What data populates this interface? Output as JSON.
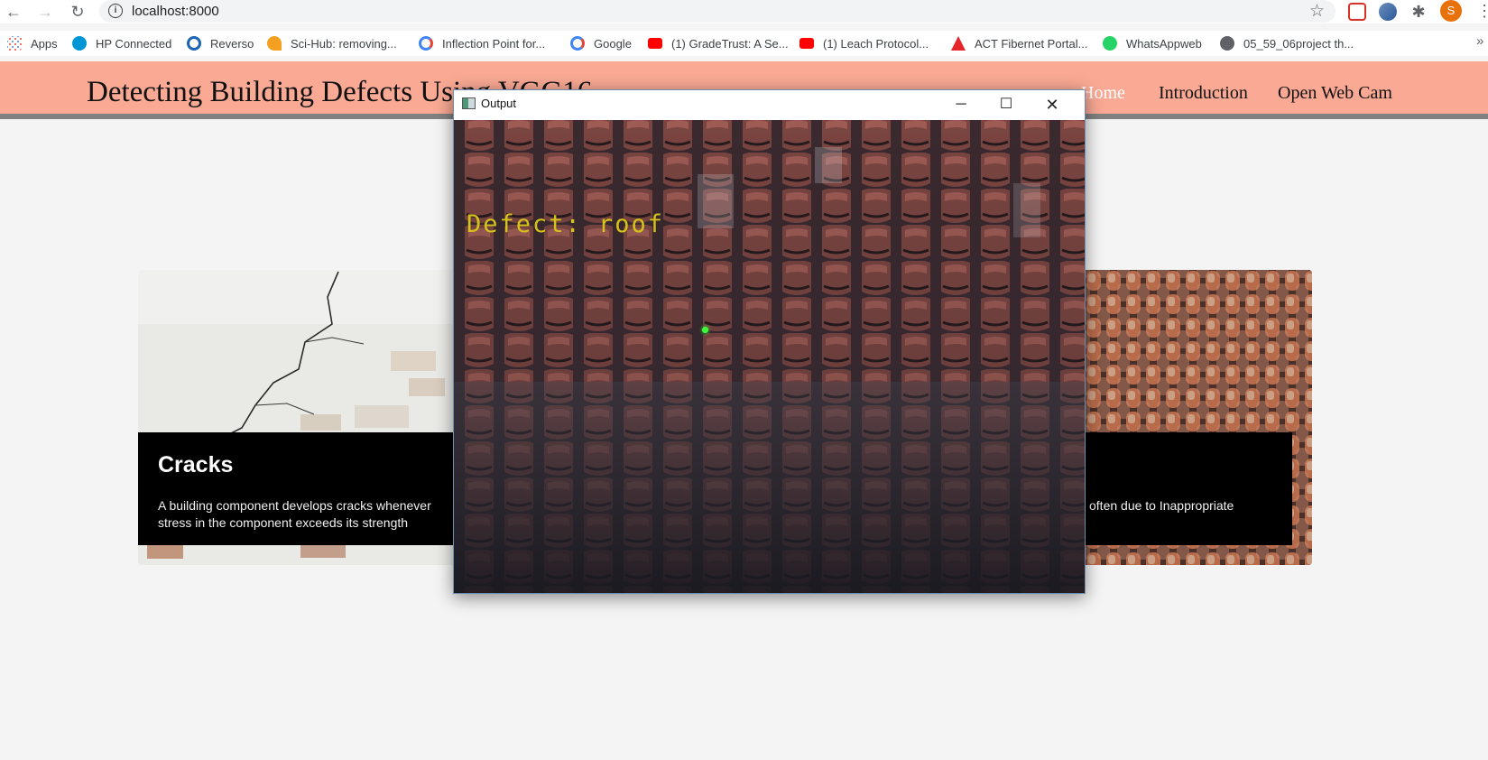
{
  "browser": {
    "url": "localhost:8000",
    "profile_initial": "S",
    "bookmarks": [
      {
        "label": "Apps",
        "icon": "apps-grid-icon"
      },
      {
        "label": "HP Connected",
        "icon": "hp-icon"
      },
      {
        "label": "Reverso",
        "icon": "reverso-icon"
      },
      {
        "label": "Sci-Hub: removing...",
        "icon": "scihub-icon"
      },
      {
        "label": "Inflection Point for...",
        "icon": "google-icon"
      },
      {
        "label": "Google",
        "icon": "google-icon"
      },
      {
        "label": "(1) GradeTrust: A Se...",
        "icon": "youtube-icon"
      },
      {
        "label": "(1) Leach Protocol...",
        "icon": "youtube-icon"
      },
      {
        "label": "ACT Fibernet Portal...",
        "icon": "act-icon"
      },
      {
        "label": "WhatsAppweb",
        "icon": "whatsapp-icon"
      },
      {
        "label": "05_59_06project th...",
        "icon": "globe-icon"
      }
    ],
    "more_label": "»"
  },
  "site": {
    "title": "Detecting Building Defects Using VGG16",
    "nav": [
      {
        "label": "Home",
        "active": true
      },
      {
        "label": "Introduction",
        "active": false
      },
      {
        "label": "Open Web Cam",
        "active": false
      }
    ]
  },
  "cards": [
    {
      "title": "Cracks",
      "text": "A building component develops cracks whenever stress in the component exceeds its strength"
    },
    {
      "title": "",
      "text": "often due to Inappropriate"
    }
  ],
  "output_window": {
    "title": "Output",
    "detection_label": "Defect: roof"
  },
  "colors": {
    "header_bg": "#f9a994",
    "caption_bg": "#000000",
    "detection_text": "#d4c21a",
    "page_bg": "#f4f4f4"
  }
}
